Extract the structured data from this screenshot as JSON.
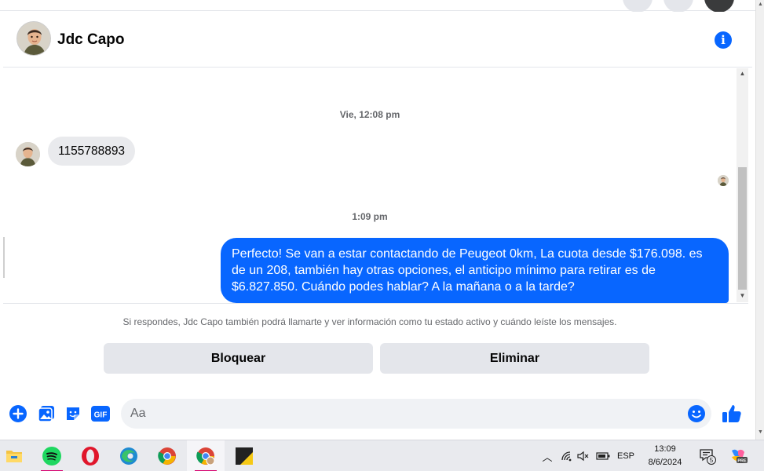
{
  "header": {
    "contact_name": "Jdc Capo"
  },
  "conversation": {
    "timestamp_1": "Vie, 12:08 pm",
    "incoming_message": "1155788893",
    "timestamp_2": "1:09 pm",
    "outgoing_message": "Perfecto!  Se van a estar contactando de Peugeot 0km, La cuota desde $176.098. es de un 208, también hay otras opciones, el anticipo mínimo para retirar es de $6.827.850. Cuándo podes hablar? A la mañana o a la tarde?"
  },
  "request_panel": {
    "notice": "Si respondes, Jdc Capo también podrá llamarte y ver información como tu estado activo y cuándo leíste los mensajes.",
    "block_label": "Bloquear",
    "delete_label": "Eliminar"
  },
  "composer": {
    "placeholder": "Aa",
    "gif_label": "GIF"
  },
  "taskbar": {
    "language": "ESP",
    "time": "13:09",
    "date": "8/6/2024",
    "notification_count": "5",
    "copilot_badge": "PRE"
  },
  "colors": {
    "accent": "#0866ff",
    "incoming_bubble": "#e9eaed",
    "secondary_text": "#65676b",
    "button_gray": "#e4e6eb"
  },
  "icons": {
    "info": "info-icon",
    "add": "plus-circle-icon",
    "photo": "photo-icon",
    "sticker": "sticker-icon",
    "gif": "gif-icon",
    "emoji": "emoji-icon",
    "like": "thumbs-up-icon"
  }
}
